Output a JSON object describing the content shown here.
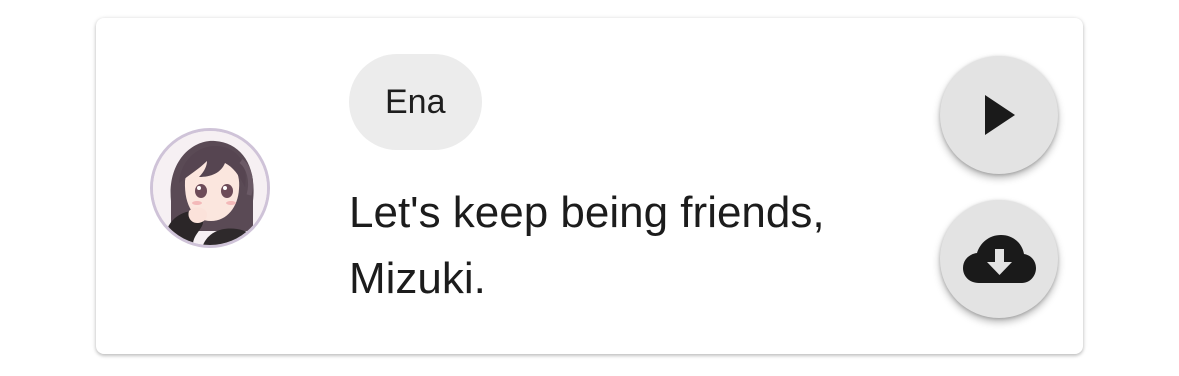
{
  "speaker": {
    "name": "Ena",
    "avatar_icon": "avatar-ena"
  },
  "message": {
    "line1": "Let's keep being friends,",
    "line2": "Mizuki."
  },
  "actions": {
    "play_icon": "play-icon",
    "download_icon": "cloud-download-icon"
  },
  "colors": {
    "card_background": "#ffffff",
    "chip_background": "#ececec",
    "fab_background": "#e3e3e3",
    "icon": "#1a1a1a",
    "avatar_ring": "#cfc3d8"
  }
}
